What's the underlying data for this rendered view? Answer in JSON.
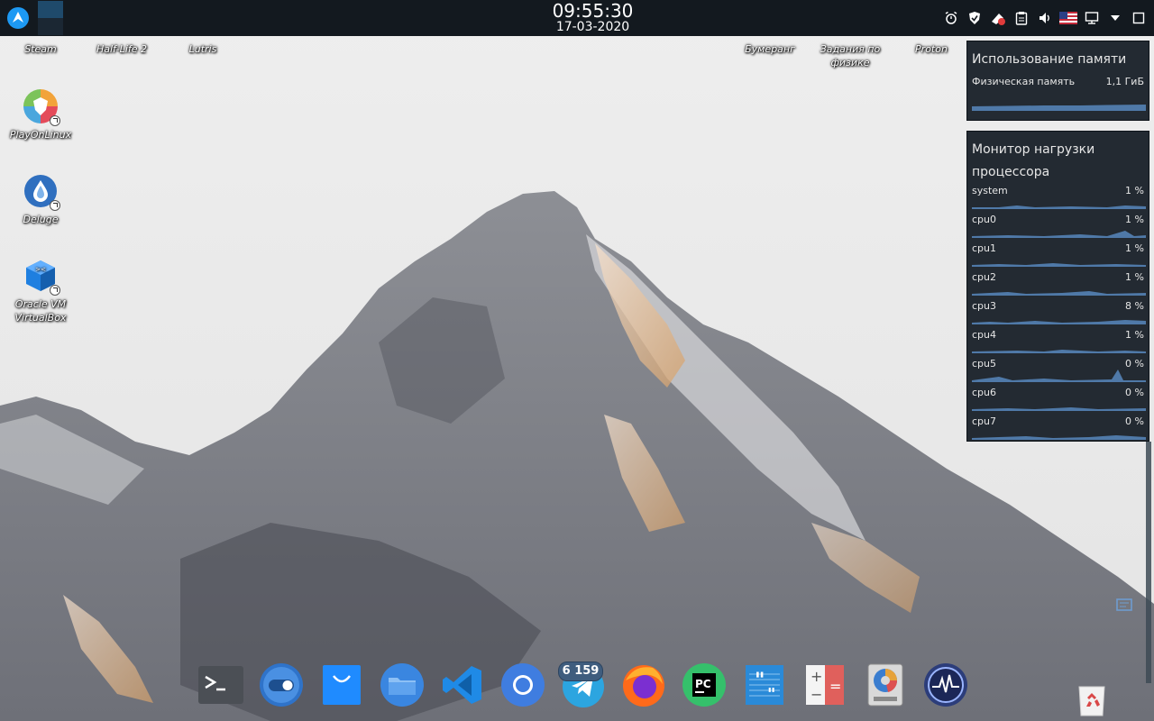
{
  "panel": {
    "clock_time": "09:55:30",
    "clock_date": "17-03-2020",
    "tray_icons": [
      "alarm-icon",
      "shield-icon",
      "sync-notify-icon",
      "clipboard-icon",
      "volume-icon",
      "us-flag-icon",
      "display-icon",
      "expand-arrow-icon",
      "maximize-icon"
    ]
  },
  "desktop": {
    "top_row": [
      "Steam",
      "Half-Life 2",
      "Lutris",
      "Бумеранг",
      "Задания по физике",
      "Proton"
    ],
    "left_column": [
      "PlayOnLinux",
      "Deluge",
      "Oracle VM VirtualBox"
    ]
  },
  "memory_widget": {
    "title": "Использование памяти",
    "rows": [
      {
        "name": "Физическая память",
        "value": "1,1 ГиБ"
      }
    ]
  },
  "cpu_widget": {
    "title": "Монитор нагрузки процессора",
    "rows": [
      {
        "name": "system",
        "value": "1 %"
      },
      {
        "name": "cpu0",
        "value": "1 %"
      },
      {
        "name": "cpu1",
        "value": "1 %"
      },
      {
        "name": "cpu2",
        "value": "1 %"
      },
      {
        "name": "cpu3",
        "value": "8 %"
      },
      {
        "name": "cpu4",
        "value": "1 %"
      },
      {
        "name": "cpu5",
        "value": "0 %"
      },
      {
        "name": "cpu6",
        "value": "0 %"
      },
      {
        "name": "cpu7",
        "value": "0 %"
      }
    ]
  },
  "dock": {
    "apps": [
      "terminal-icon",
      "toggle-switch-icon",
      "store-bag-icon",
      "file-manager-icon",
      "vscode-icon",
      "chromium-icon",
      "telegram-icon",
      "firefox-icon",
      "pycharm-icon",
      "quote-notes-icon",
      "calculator-icon",
      "disk-usage-icon",
      "system-monitor-icon"
    ],
    "telegram_badge": "6 159"
  },
  "colors": {
    "panel_bg": "#13191f",
    "widget_bg": "#161e26",
    "graph_fill": "#4f79a8",
    "accent": "#1d99f3"
  }
}
